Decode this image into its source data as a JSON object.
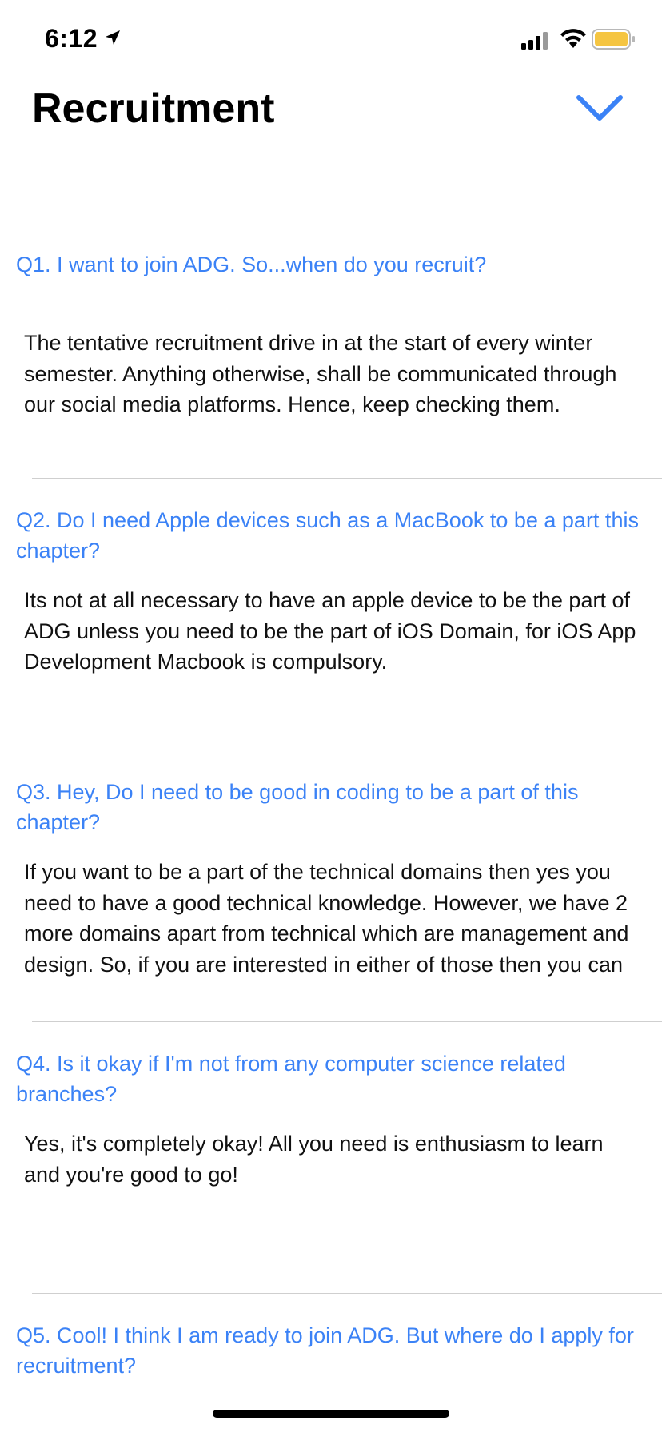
{
  "status_bar": {
    "time": "6:12",
    "battery_color": "#f5c542"
  },
  "header": {
    "title": "Recruitment",
    "accent_color": "#3b82f6",
    "collapse_icon": "chevron-down-icon"
  },
  "faqs": [
    {
      "question": "Q1. I want to join ADG. So...when do you recruit?",
      "answer": "The tentative recruitment drive in at the start of every winter semester. Anything otherwise, shall be communicated through our social media platforms. Hence, keep checking them."
    },
    {
      "question": "Q2. Do I need Apple devices such as a MacBook to be a part this chapter?",
      "answer": "Its not at all necessary to have an apple device to be the part of ADG unless you need to be the part of iOS Domain, for iOS App Development Macbook is compulsory."
    },
    {
      "question": "Q3. Hey, Do I need to be good in coding to be a part of this chapter?",
      "answer": "If you want to be a part of the technical domains then yes you need to have a good technical knowledge. However, we have 2 more domains apart from technical which are management and design. So, if you are interested in either of those then you can definitely apply!"
    },
    {
      "question": "Q4. Is it okay if I'm not from any computer science related branches?",
      "answer": "Yes, it's completely okay! All you need is enthusiasm to learn and you're good to go!"
    },
    {
      "question": "Q5. Cool! I think I am ready to join ADG. But where do I apply for recruitment?",
      "answer": ""
    }
  ]
}
